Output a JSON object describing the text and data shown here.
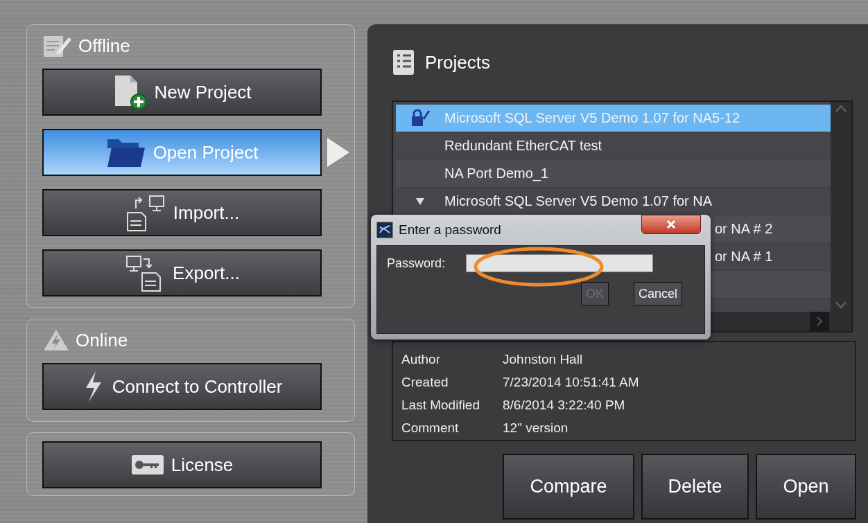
{
  "offline": {
    "title": "Offline",
    "buttons": [
      {
        "label": "New Project",
        "kind": "new",
        "selected": false
      },
      {
        "label": "Open Project",
        "kind": "open",
        "selected": true
      },
      {
        "label": "Import...",
        "kind": "import",
        "selected": false
      },
      {
        "label": "Export...",
        "kind": "export",
        "selected": false
      }
    ]
  },
  "online": {
    "title": "Online",
    "buttons": [
      {
        "label": "Connect to Controller",
        "kind": "connect",
        "selected": false
      }
    ]
  },
  "license": {
    "buttons": [
      {
        "label": "License",
        "kind": "license",
        "selected": false
      }
    ]
  },
  "projects": {
    "title": "Projects",
    "rows": [
      {
        "name": "Microsoft SQL Server V5 Demo 1.07 for NA5-12",
        "kind": "icon",
        "selected": true
      },
      {
        "name": "Redundant EtherCAT test",
        "kind": "plain",
        "selected": false
      },
      {
        "name": "NA Port Demo_1",
        "kind": "plain",
        "selected": false
      },
      {
        "name": "Microsoft SQL Server V5 Demo 1.07 for NA",
        "kind": "group",
        "expanded": true,
        "selected": false
      },
      {
        "name": "or NA # 2",
        "kind": "clipped",
        "selected": false
      },
      {
        "name": "or NA # 1",
        "kind": "clipped",
        "selected": false
      },
      {
        "kind": "plain",
        "selected": false
      }
    ]
  },
  "details": [
    {
      "label": "Author",
      "value": "Johnston Hall"
    },
    {
      "label": "Created",
      "value": "7/23/2014 10:51:41 AM"
    },
    {
      "label": "Last Modified",
      "value": "8/6/2014 3:22:40 PM"
    },
    {
      "label": "Comment",
      "value": "12\" version"
    }
  ],
  "actions": [
    "Compare",
    "Delete",
    "Open"
  ],
  "dialog": {
    "title": "Enter a password",
    "field_label": "Password:",
    "buttons": [
      {
        "label": "OK",
        "disabled": true
      },
      {
        "label": "Cancel",
        "disabled": false
      }
    ]
  }
}
